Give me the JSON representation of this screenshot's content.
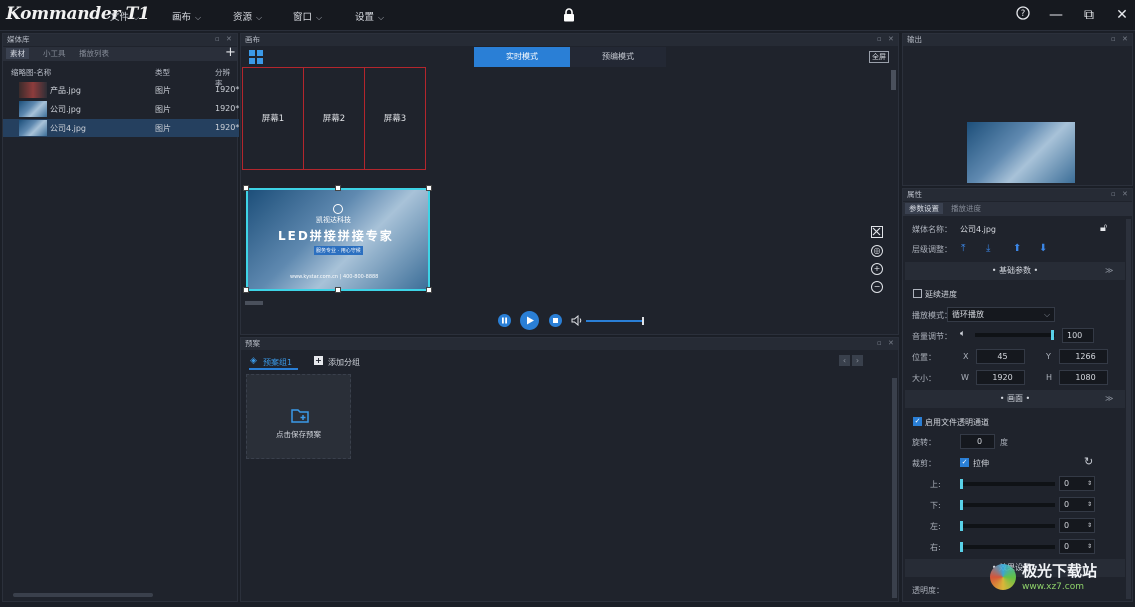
{
  "app": {
    "logo": "Kommander T1",
    "menus": [
      {
        "label": "文件"
      },
      {
        "label": "画布"
      },
      {
        "label": "资源"
      },
      {
        "label": "窗口"
      },
      {
        "label": "设置"
      }
    ]
  },
  "media": {
    "panel_title": "媒体库",
    "tabs": [
      "素材",
      "小工具",
      "播放列表"
    ],
    "add_label": "+",
    "columns": [
      "缩略图-名称",
      "类型",
      "分辨率"
    ],
    "rows": [
      {
        "name": "产品.jpg",
        "type": "图片",
        "res": "1920*"
      },
      {
        "name": "公司.jpg",
        "type": "图片",
        "res": "1920*"
      },
      {
        "name": "公司4.jpg",
        "type": "图片",
        "res": "1920*"
      }
    ]
  },
  "canvas": {
    "panel_title": "画布",
    "modes": [
      "实时模式",
      "预编模式"
    ],
    "fullscreen_label": "全屏",
    "screens": [
      "屏幕1",
      "屏幕2",
      "屏幕3"
    ],
    "image_text": {
      "brand": "凯视达科技",
      "headline": "LED拼接拼接专家",
      "subtitle": "服务专业 · 用心守候",
      "url": "www.kystar.com.cn | 400-800-8888"
    }
  },
  "preset": {
    "panel_title": "预案",
    "group_tab": "预案组1",
    "add_group": "添加分组",
    "save_card": "点击保存预案"
  },
  "output": {
    "panel_title": "输出"
  },
  "props": {
    "panel_title": "属性",
    "tabs": [
      "参数设置",
      "播放进度"
    ],
    "media_name_label": "媒体名称：",
    "media_name": "公司4.jpg",
    "layer_label": "层级调整：",
    "basic_section": "• 基础参数 •",
    "continue_label": "延续进度",
    "play_mode_label": "播放模式：",
    "play_mode": "循环播放",
    "volume_label": "音量调节：",
    "volume": "100",
    "position_label": "位置：",
    "x_label": "X",
    "x": "45",
    "y_label": "Y",
    "y": "1266",
    "size_label": "大小：",
    "w_label": "W",
    "w": "1920",
    "h_label": "H",
    "h": "1080",
    "picture_section": "• 画面 •",
    "alpha_label": "启用文件透明通道",
    "rotate_label": "旋转：",
    "rotate": "0",
    "rotate_unit": "度",
    "crop_label": "裁剪：",
    "stretch_label": "拉伸",
    "crop_top": "上:",
    "crop_bottom": "下:",
    "crop_left": "左:",
    "crop_right": "右:",
    "crop_value": "0",
    "effect_section": "• 效果设置 •",
    "opacity_label": "透明度："
  },
  "watermark": {
    "text": "极光下载站",
    "url": "www.xz7.com"
  },
  "colors": {
    "accent": "#2a7fd6",
    "selection": "#25405f",
    "screen_border": "#b3262d",
    "cyan": "#59d1e8"
  }
}
